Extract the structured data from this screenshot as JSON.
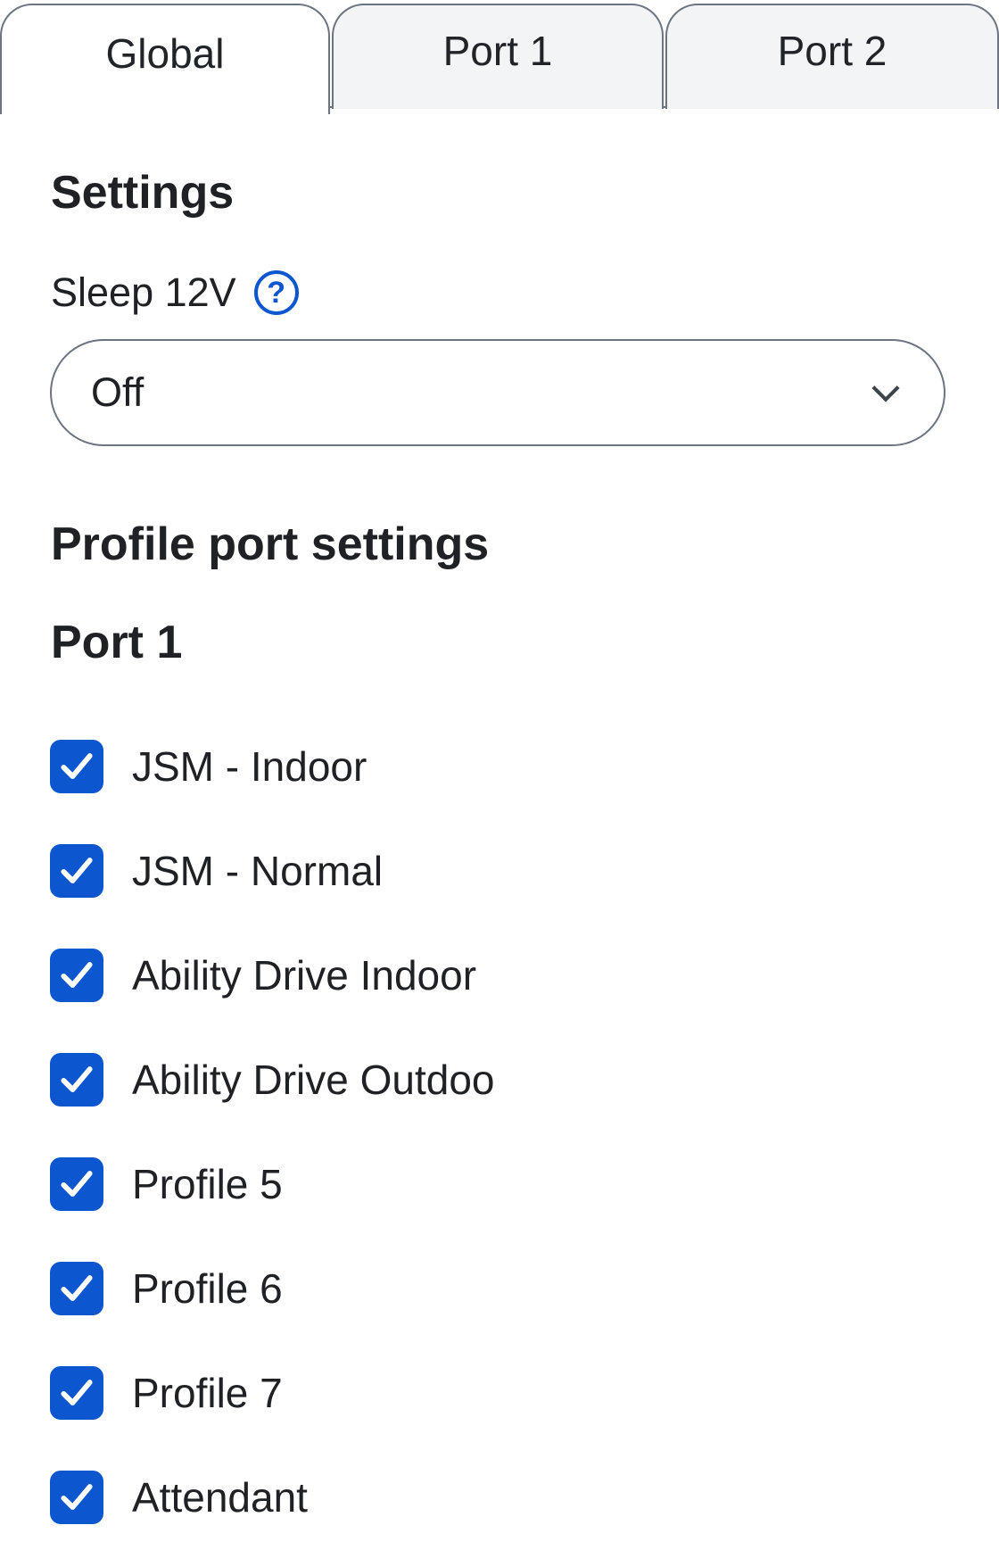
{
  "tabs": [
    {
      "label": "Global",
      "active": true
    },
    {
      "label": "Port 1",
      "active": false
    },
    {
      "label": "Port 2",
      "active": false
    }
  ],
  "settings": {
    "title": "Settings",
    "sleep_label": "Sleep 12V",
    "help_icon": "question-circle-icon",
    "sleep_value": "Off"
  },
  "profile": {
    "title": "Profile port settings",
    "port_title": "Port 1",
    "items": [
      {
        "label": "JSM - Indoor",
        "checked": true
      },
      {
        "label": "JSM - Normal",
        "checked": true
      },
      {
        "label": "Ability Drive Indoor",
        "checked": true
      },
      {
        "label": "Ability Drive Outdoo",
        "checked": true
      },
      {
        "label": "Profile 5",
        "checked": true
      },
      {
        "label": "Profile 6",
        "checked": true
      },
      {
        "label": "Profile 7",
        "checked": true
      },
      {
        "label": "Attendant",
        "checked": true
      }
    ]
  },
  "colors": {
    "accent": "#0c56cf",
    "border": "#6b7480",
    "text": "#1f2124",
    "inactive_tab_bg": "#f3f4f6"
  }
}
